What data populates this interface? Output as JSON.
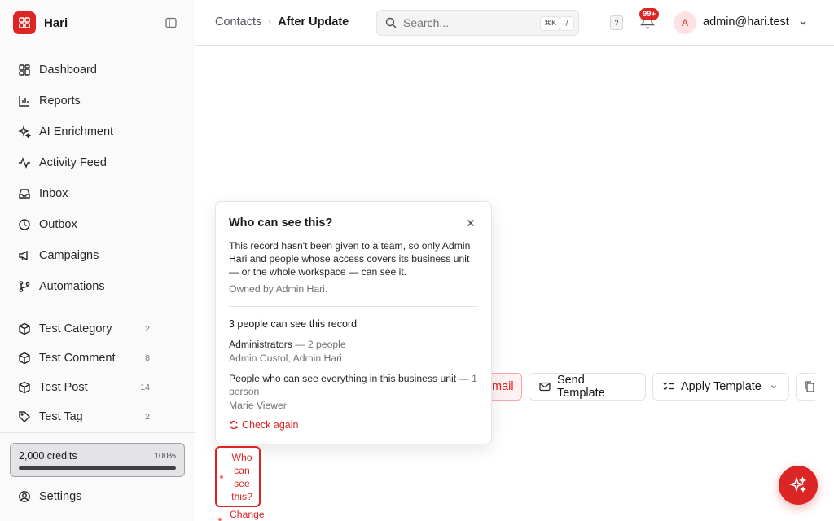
{
  "app": {
    "name": "Hari"
  },
  "sidebar": {
    "items": [
      {
        "label": "Dashboard",
        "icon": "dashboard-icon"
      },
      {
        "label": "Reports",
        "icon": "bar-chart-icon"
      },
      {
        "label": "AI Enrichment",
        "icon": "sparkles-icon"
      },
      {
        "label": "Activity Feed",
        "icon": "activity-icon"
      },
      {
        "label": "Inbox",
        "icon": "inbox-icon"
      },
      {
        "label": "Outbox",
        "icon": "clock-icon"
      },
      {
        "label": "Campaigns",
        "icon": "megaphone-icon"
      },
      {
        "label": "Automations",
        "icon": "git-branch-icon"
      }
    ],
    "entities": [
      {
        "label": "Test Category",
        "count": "2",
        "icon": "cube-icon"
      },
      {
        "label": "Test Comment",
        "count": "8",
        "icon": "cube-icon"
      },
      {
        "label": "Test Post",
        "count": "14",
        "icon": "cube-icon"
      },
      {
        "label": "Test Tag",
        "count": "2",
        "icon": "tag-icon"
      }
    ],
    "credits": {
      "label": "2,000 credits",
      "percent_label": "100%",
      "fraction": 1.0
    },
    "settings": {
      "label": "Settings",
      "icon": "user-circle-icon"
    }
  },
  "topbar": {
    "breadcrumb": {
      "root": "Contacts",
      "separator": "›",
      "current": "After Update"
    },
    "search": {
      "placeholder": "Search...",
      "shortcut": "⌘K",
      "slash": "/"
    },
    "help": "?",
    "notifications": {
      "badge": "99+"
    },
    "user": {
      "avatar_initial": "A",
      "email": "admin@hari.test"
    }
  },
  "toolbar": {
    "email_label": "mail",
    "send_template_label": "Send Template",
    "apply_template_label": "Apply Template"
  },
  "popover": {
    "title": "Who can see this?",
    "description": "This record hasn't been given to a team, so only Admin Hari and people whose access covers its business unit — or the whole workspace — can see it.",
    "owner": "Owned by Admin Hari.",
    "count_label": "3 people can see this record",
    "groups": [
      {
        "title": "Administrators",
        "meta": " — 2 people",
        "members": "Admin Custol, Admin Hari"
      },
      {
        "title": "People who can see everything in this business unit",
        "meta": " — 1 person",
        "members": "Marie Viewer"
      }
    ],
    "check_again": "Check again"
  },
  "visibility_chip": {
    "label": "Who can see this?",
    "change_label": "Change"
  },
  "colors": {
    "accent": "#dc2626",
    "border": "#e4e4e7",
    "muted": "#71717a"
  }
}
